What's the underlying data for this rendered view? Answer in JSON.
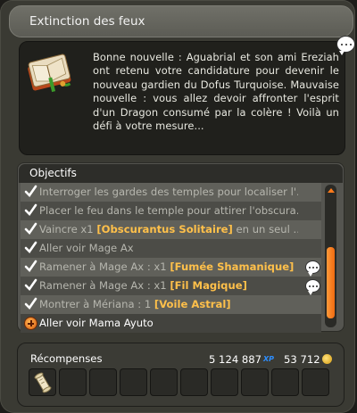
{
  "window": {
    "title": "Extinction des feux"
  },
  "description": {
    "text": "Bonne nouvelle : Aguabrial et son ami Ereziah ont retenu votre candidature pour devenir le nouveau gardien du Dofus Turquoise. Mauvaise nouvelle : vous allez devoir affronter l'esprit d'un Dragon consumé par la colère ! Voilà un défi à votre mesure..."
  },
  "objectives": {
    "header": "Objectifs",
    "items": [
      {
        "status": "done",
        "text": "Interroger les gardes des temples pour localiser l'..."
      },
      {
        "status": "done",
        "text": "Placer le feu dans le temple pour attirer l'obscura..."
      },
      {
        "status": "done",
        "prefix": "Vaincre x1 ",
        "highlight": "[Obscurantus Solitaire]",
        "suffix": " en un seul ..."
      },
      {
        "status": "done",
        "text": "Aller voir Mage Ax"
      },
      {
        "status": "done",
        "prefix": "Ramener à Mage Ax : x1 ",
        "highlight": "[Fumée Shamanique]",
        "suffix": "",
        "has_dialog": true
      },
      {
        "status": "done",
        "prefix": "Ramener à Mage Ax : x1 ",
        "highlight": "[Fil Magique]",
        "suffix": "",
        "has_dialog": true
      },
      {
        "status": "done",
        "prefix": "Montrer à Mériana : 1 ",
        "highlight": "[Voile Astral]",
        "suffix": ""
      },
      {
        "status": "current",
        "text": "Aller voir Mama Ayuto"
      }
    ],
    "scroll_position": 0.45
  },
  "rewards": {
    "label": "Récompenses",
    "xp_value": "5 124 887",
    "xp_tag": "XP",
    "kamas_value": "53 712",
    "kamas_tag": "K",
    "slot_count": 10,
    "first_slot_item": "scroll-icon"
  },
  "colors": {
    "highlight": "#ffc04a",
    "accent_orange": "#f06a10",
    "xp_blue": "#2d8eff",
    "panel_bg": "#3a3a33"
  }
}
